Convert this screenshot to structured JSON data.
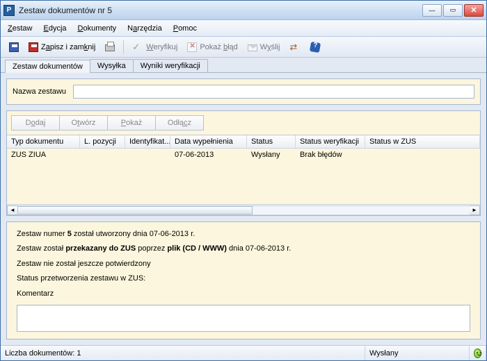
{
  "window": {
    "title": "Zestaw dokumentów nr 5",
    "app_icon_letter": "P"
  },
  "menu": {
    "zestaw": "Zestaw",
    "edycja": "Edycja",
    "dokumenty": "Dokumenty",
    "narzedzia": "Narzędzia",
    "pomoc": "Pomoc"
  },
  "toolbar": {
    "save_close_label": "Zapisz i zamknij",
    "weryfikuj_label": "Weryfikuj",
    "pokaz_blad_label": "Pokaż błąd",
    "wyslij_label": "Wyślij"
  },
  "tabs": {
    "t0": "Zestaw dokumentów",
    "t1": "Wysyłka",
    "t2": "Wyniki weryfikacji"
  },
  "name_section": {
    "label": "Nazwa zestawu",
    "value": ""
  },
  "table_buttons": {
    "dodaj": "Dodaj",
    "otworz": "Otwórz",
    "pokaz": "Pokaż",
    "odlacz": "Odłącz"
  },
  "columns": {
    "typ": "Typ dokumentu",
    "lp": "L. pozycji",
    "id": "Identyfikat...",
    "data": "Data wypełnienia",
    "status": "Status",
    "swer": "Status weryfikacji",
    "szus": "Status w ZUS"
  },
  "rows": [
    {
      "typ": "ZUS ZIUA",
      "lp": "",
      "id": "",
      "data": "07-06-2013",
      "status": "Wysłany",
      "swer": "Brak błędów",
      "szus": ""
    }
  ],
  "info": {
    "line1_pre": "Zestaw numer ",
    "line1_num": "5",
    "line1_post": " został utworzony dnia 07-06-2013 r.",
    "line2_pre": "Zestaw został ",
    "line2_b1": "przekazany do ZUS",
    "line2_mid": " poprzez ",
    "line2_b2": "plik (CD / WWW)",
    "line2_post": " dnia 07-06-2013 r.",
    "line3": "Zestaw nie został jeszcze potwierdzony",
    "line4": "Status przetworzenia zestawu w ZUS:",
    "comment_label": "Komentarz",
    "comment_value": ""
  },
  "status": {
    "docs_label": "Liczba dokumentów: 1",
    "state": "Wysłany"
  }
}
